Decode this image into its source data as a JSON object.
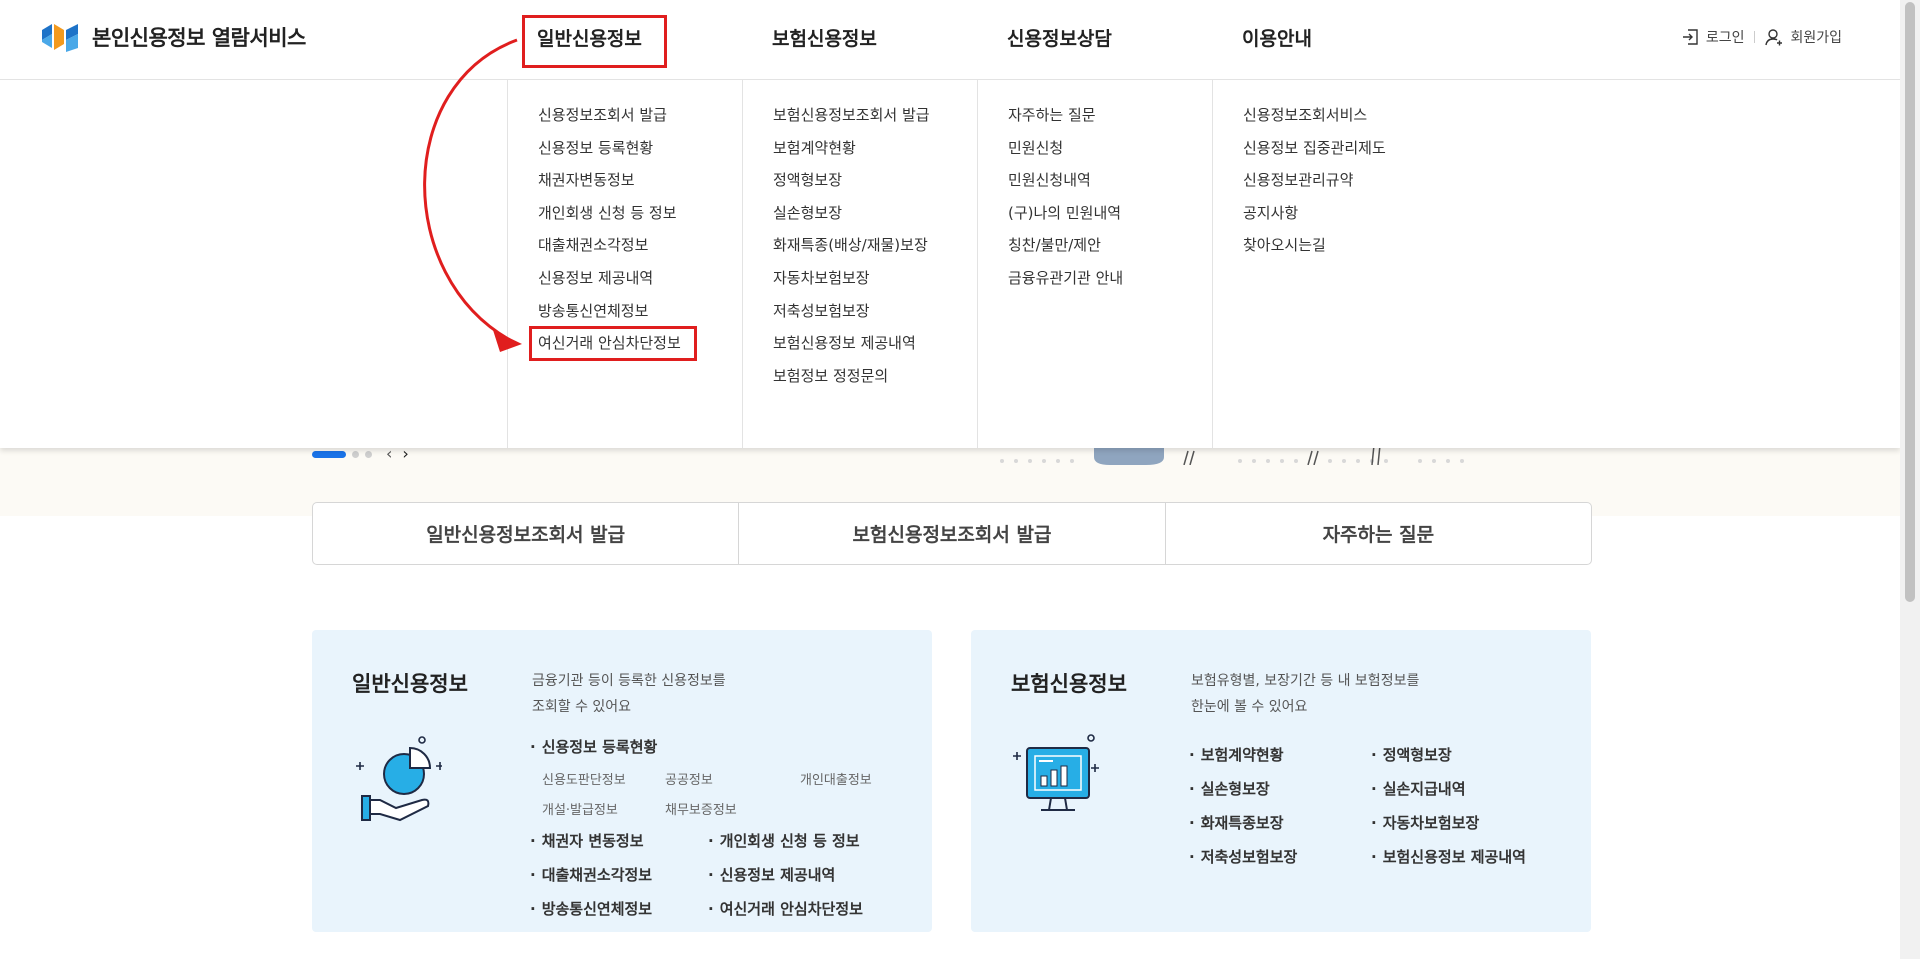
{
  "header": {
    "logo_text": "본인신용정보 열람서비스",
    "nav": [
      "일반신용정보",
      "보험신용정보",
      "신용정보상담",
      "이용안내"
    ],
    "util": {
      "login": "로그인",
      "signup": "회원가입"
    }
  },
  "mega_menu": {
    "columns": [
      [
        "신용정보조회서 발급",
        "신용정보 등록현황",
        "채권자변동정보",
        "개인회생 신청 등 정보",
        "대출채권소각정보",
        "신용정보 제공내역",
        "방송통신연체정보",
        "여신거래 안심차단정보"
      ],
      [
        "보험신용정보조회서 발급",
        "보험계약현황",
        "정액형보장",
        "실손형보장",
        "화재특종(배상/재물)보장",
        "자동차보험보장",
        "저축성보험보장",
        "보험신용정보 제공내역",
        "보험정보 정정문의"
      ],
      [
        "자주하는 질문",
        "민원신청",
        "민원신청내역",
        "(구)나의 민원내역",
        "칭찬/불만/제안",
        "금융유관기관 안내"
      ],
      [
        "신용정보조회서비스",
        "신용정보 집중관리제도",
        "신용정보관리규약",
        "공지사항",
        "찾아오시는길"
      ]
    ]
  },
  "quick_links": [
    "일반신용정보조회서 발급",
    "보험신용정보조회서 발급",
    "자주하는 질문"
  ],
  "card_general": {
    "title": "일반신용정보",
    "desc_line1": "금융기관 등이 등록한 신용정보를",
    "desc_line2": "조회할 수 있어요",
    "sub_head": "신용정보 등록현황",
    "minor": [
      "신용도판단정보",
      "공공정보",
      "개인대출정보",
      "개설·발급정보",
      "채무보증정보"
    ],
    "links": [
      "채권자 변동정보",
      "개인회생 신청 등 정보",
      "대출채권소각정보",
      "신용정보 제공내역",
      "방송통신연체정보",
      "여신거래 안심차단정보"
    ]
  },
  "card_insurance": {
    "title": "보험신용정보",
    "desc_line1": "보험유형별, 보장기간 등 내 보험정보를",
    "desc_line2": "한눈에 볼 수 있어요",
    "links": [
      "보험계약현황",
      "정액형보장",
      "실손형보장",
      "실손지급내역",
      "화재특종보장",
      "자동차보험보장",
      "저축성보험보장",
      "보험신용정보 제공내역"
    ]
  },
  "colors": {
    "accent": "#1a73e8",
    "highlight": "#e01e1e",
    "card_bg": "#e9f4fc"
  },
  "slider": {
    "active_index": 0,
    "count": 3
  }
}
